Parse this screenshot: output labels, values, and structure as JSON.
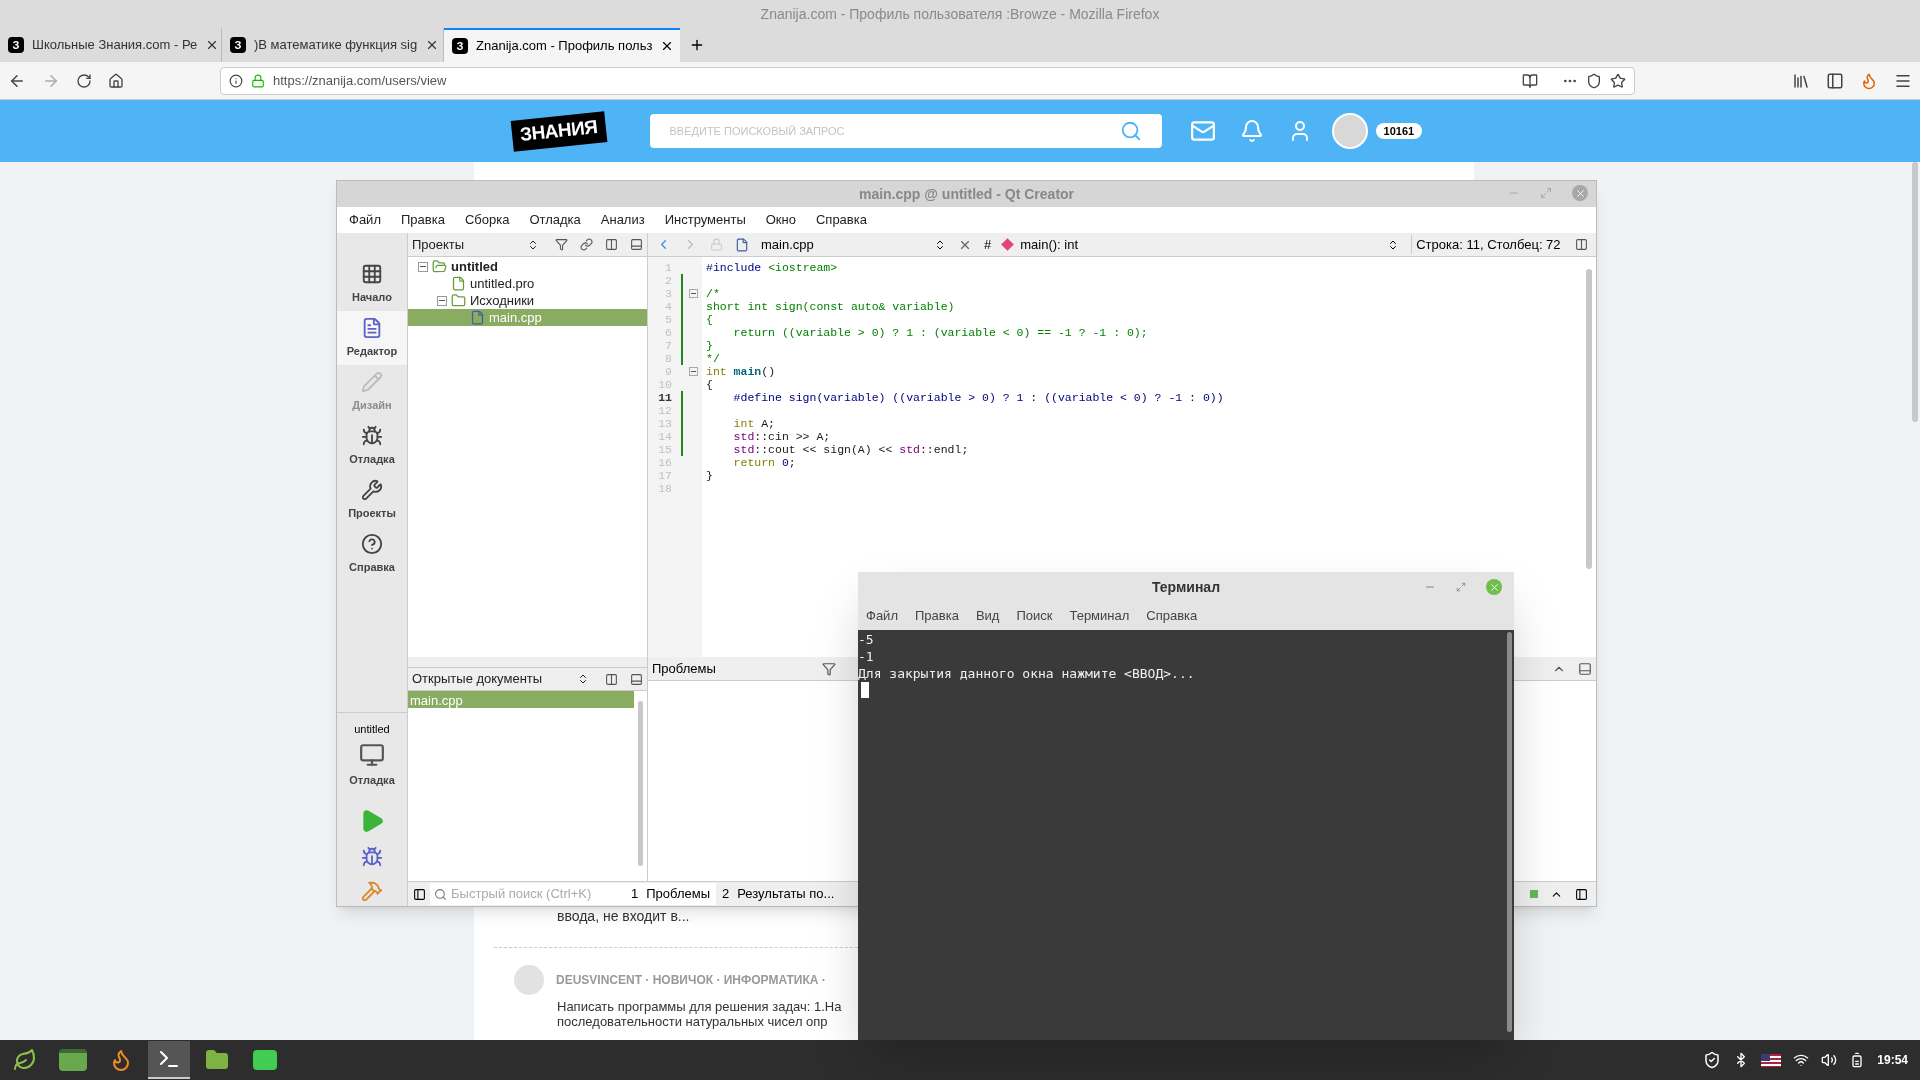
{
  "browser": {
    "window_title": "Znanija.com - Профиль пользователя :Browze - Mozilla Firefox",
    "tabs": [
      {
        "favicon": "З",
        "title": "Школьные Знания.com - Ре",
        "selected": false
      },
      {
        "favicon": "З",
        "title": ")В математике функция sig",
        "selected": false
      },
      {
        "favicon": "З",
        "title": "Znanija.com - Профиль польз",
        "selected": true
      }
    ],
    "url": "https://znanija.com/users/view"
  },
  "site": {
    "logo": "ЗНАНИЯ",
    "search": {
      "placeholder": "ВВЕДИТЕ ПОИСКОВЫЙ ЗАПРОС"
    },
    "points": "10161"
  },
  "page": {
    "excerpt": "ввода, не входит в...",
    "post": {
      "meta": "DEUSVINCENT · НОВИЧОК · ИНФОРМАТИКА ·",
      "text_lines": [
        "Написать программы для решения задач: 1.На",
        "последовательности натуральных чисел опр"
      ]
    }
  },
  "qt": {
    "title": "main.cpp @ untitled - Qt Creator",
    "menu": [
      "Файл",
      "Правка",
      "Сборка",
      "Отладка",
      "Анализ",
      "Инструменты",
      "Окно",
      "Справка"
    ],
    "modes": [
      {
        "kind": "welcome",
        "label": "Начало",
        "selected": false,
        "disabled": false
      },
      {
        "kind": "edit",
        "label": "Редактор",
        "selected": true,
        "disabled": false
      },
      {
        "kind": "design",
        "label": "Дизайн",
        "selected": false,
        "disabled": true
      },
      {
        "kind": "debug",
        "label": "Отладка",
        "selected": false,
        "disabled": false
      },
      {
        "kind": "projects",
        "label": "Проекты",
        "selected": false,
        "disabled": false
      },
      {
        "kind": "help",
        "label": "Справка",
        "selected": false,
        "disabled": false
      }
    ],
    "kit": {
      "project": "untitled",
      "build": "Отладка"
    },
    "projects_panel": {
      "title": "Проекты",
      "tree": [
        {
          "kind": "project",
          "label": "untitled",
          "expanded": true,
          "selected": false,
          "children": [
            {
              "kind": "pro",
              "label": "untitled.pro",
              "selected": false
            },
            {
              "kind": "folder",
              "label": "Исходники",
              "expanded": true,
              "selected": false,
              "children": [
                {
                  "kind": "cpp",
                  "label": "main.cpp",
                  "selected": true
                }
              ]
            }
          ]
        }
      ]
    },
    "open_documents": {
      "title": "Открытые документы",
      "items": [
        {
          "label": "main.cpp",
          "selected": true
        }
      ]
    },
    "editor": {
      "file": "main.cpp",
      "symbol_marker": "#",
      "symbol": "main(): int",
      "position": "Строка: 11, Столбец: 72",
      "lines": [
        {
          "number": "1",
          "current": false,
          "modified": false,
          "fold": false,
          "segments": [
            {
              "kind": "preproc",
              "text": "#include "
            },
            {
              "kind": "string",
              "text": "<iostream>"
            }
          ]
        },
        {
          "number": "2",
          "current": false,
          "modified": true,
          "fold": false
        },
        {
          "number": "3",
          "current": false,
          "modified": true,
          "fold": true,
          "segments": [
            {
              "kind": "comment",
              "text": "/*"
            }
          ]
        },
        {
          "number": "4",
          "current": false,
          "modified": true,
          "fold": false,
          "segments": [
            {
              "kind": "comment",
              "text": "short int sign(const auto& variable)"
            }
          ]
        },
        {
          "number": "5",
          "current": false,
          "modified": true,
          "fold": false,
          "segments": [
            {
              "kind": "comment",
              "text": "{"
            }
          ]
        },
        {
          "number": "6",
          "current": false,
          "modified": true,
          "fold": false,
          "segments": [
            {
              "kind": "comment",
              "text": "    return ((variable > 0) ? 1 : (variable < 0) == -1 ? -1 : 0);"
            }
          ]
        },
        {
          "number": "7",
          "current": false,
          "modified": true,
          "fold": false,
          "segments": [
            {
              "kind": "comment",
              "text": "}"
            }
          ]
        },
        {
          "number": "8",
          "current": false,
          "modified": true,
          "fold": false,
          "segments": [
            {
              "kind": "comment",
              "text": "*/"
            }
          ]
        },
        {
          "number": "9",
          "current": false,
          "modified": false,
          "fold": true,
          "segments": [
            {
              "kind": "keyword",
              "text": "int"
            },
            {
              "kind": "function",
              "text": " main"
            },
            {
              "kind": "plain",
              "text": "()"
            }
          ]
        },
        {
          "number": "10",
          "current": false,
          "modified": false,
          "fold": false,
          "segments": [
            {
              "kind": "plain",
              "text": "{"
            }
          ]
        },
        {
          "number": "11",
          "current": true,
          "modified": true,
          "fold": false,
          "segments": [
            {
              "kind": "preproc",
              "text": "    #define sign(variable) ((variable > 0) ? 1 : ((variable < 0) ? -1 : 0))"
            }
          ]
        },
        {
          "number": "12",
          "current": false,
          "modified": true,
          "fold": false
        },
        {
          "number": "13",
          "current": false,
          "modified": true,
          "fold": false,
          "segments": [
            {
              "kind": "keyword",
              "text": "    int"
            },
            {
              "kind": "plain",
              "text": " A;"
            }
          ]
        },
        {
          "number": "14",
          "current": false,
          "modified": true,
          "fold": false,
          "segments": [
            {
              "kind": "namespace",
              "text": "    std"
            },
            {
              "kind": "plain",
              "text": "::cin >> A;"
            }
          ]
        },
        {
          "number": "15",
          "current": false,
          "modified": true,
          "fold": false,
          "segments": [
            {
              "kind": "namespace",
              "text": "    std"
            },
            {
              "kind": "plain",
              "text": "::cout << sign(A) << "
            },
            {
              "kind": "namespace",
              "text": "std"
            },
            {
              "kind": "plain",
              "text": "::endl;"
            }
          ]
        },
        {
          "number": "16",
          "current": false,
          "modified": false,
          "fold": false,
          "segments": [
            {
              "kind": "keyword",
              "text": "    return"
            },
            {
              "kind": "number",
              "text": " 0"
            },
            {
              "kind": "plain",
              "text": ";"
            }
          ]
        },
        {
          "number": "17",
          "current": false,
          "modified": false,
          "fold": false,
          "segments": [
            {
              "kind": "plain",
              "text": "}"
            }
          ]
        },
        {
          "number": "18",
          "current": false,
          "modified": false,
          "fold": false
        }
      ]
    },
    "problems": {
      "title": "Проблемы"
    },
    "quick_search": {
      "placeholder": "Быстрый поиск (Ctrl+K)"
    },
    "output_tabs": [
      {
        "number": "1",
        "label": "Проблемы",
        "selected": true
      },
      {
        "number": "2",
        "label": "Результаты по...",
        "selected": false
      }
    ]
  },
  "terminal": {
    "title": "Терминал",
    "menu": [
      "Файл",
      "Правка",
      "Вид",
      "Поиск",
      "Терминал",
      "Справка"
    ],
    "output": [
      "-5",
      "-1",
      "Для закрытия данного окна нажмите <ВВОД>..."
    ]
  },
  "taskbar": {
    "apps": [
      {
        "kind": "menu",
        "active": false
      },
      {
        "kind": "desktop",
        "active": false
      },
      {
        "kind": "firefox",
        "active": false
      },
      {
        "kind": "terminal",
        "active": true
      },
      {
        "kind": "files",
        "active": false
      },
      {
        "kind": "qt",
        "active": false
      }
    ],
    "clock": "19:54"
  }
}
